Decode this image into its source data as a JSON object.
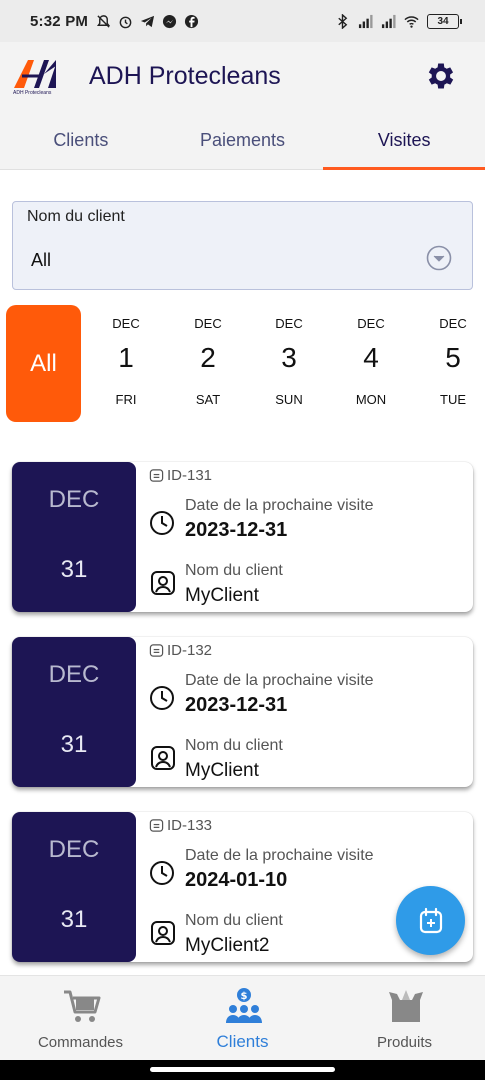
{
  "status_bar": {
    "time": "5:32 PM",
    "battery": "34"
  },
  "app": {
    "title": "ADH Protecleans",
    "logo_caption": "ADH Protecleans"
  },
  "tabs": [
    {
      "label": "Clients",
      "active": false
    },
    {
      "label": "Paiements",
      "active": false
    },
    {
      "label": "Visites",
      "active": true
    }
  ],
  "filter": {
    "label": "Nom du client",
    "value": "All"
  },
  "date_strip": {
    "all_label": "All",
    "days": [
      {
        "month": "DEC",
        "day": "1",
        "weekday": "FRI"
      },
      {
        "month": "DEC",
        "day": "2",
        "weekday": "SAT"
      },
      {
        "month": "DEC",
        "day": "3",
        "weekday": "SUN"
      },
      {
        "month": "DEC",
        "day": "4",
        "weekday": "MON"
      },
      {
        "month": "DEC",
        "day": "5",
        "weekday": "TUE"
      }
    ]
  },
  "visits": [
    {
      "month": "DEC",
      "day": "31",
      "id": "ID-131",
      "next_visit_label": "Date de la prochaine visite",
      "next_visit": "2023-12-31",
      "client_label": "Nom du client",
      "client": "MyClient"
    },
    {
      "month": "DEC",
      "day": "31",
      "id": "ID-132",
      "next_visit_label": "Date de la prochaine visite",
      "next_visit": "2023-12-31",
      "client_label": "Nom du client",
      "client": "MyClient"
    },
    {
      "month": "DEC",
      "day": "31",
      "id": "ID-133",
      "next_visit_label": "Date de la prochaine visite",
      "next_visit": "2024-01-10",
      "client_label": "Nom du client",
      "client": "MyClient2"
    }
  ],
  "bottom_nav": [
    {
      "label": "Commandes",
      "icon": "cart-icon",
      "active": false
    },
    {
      "label": "Clients",
      "icon": "clients-icon",
      "active": true
    },
    {
      "label": "Produits",
      "icon": "box-icon",
      "active": false
    }
  ],
  "colors": {
    "brand": "#1d1554",
    "accent": "#ff5a0a",
    "fab": "#2f9be8",
    "active_nav": "#2f7fd9"
  }
}
